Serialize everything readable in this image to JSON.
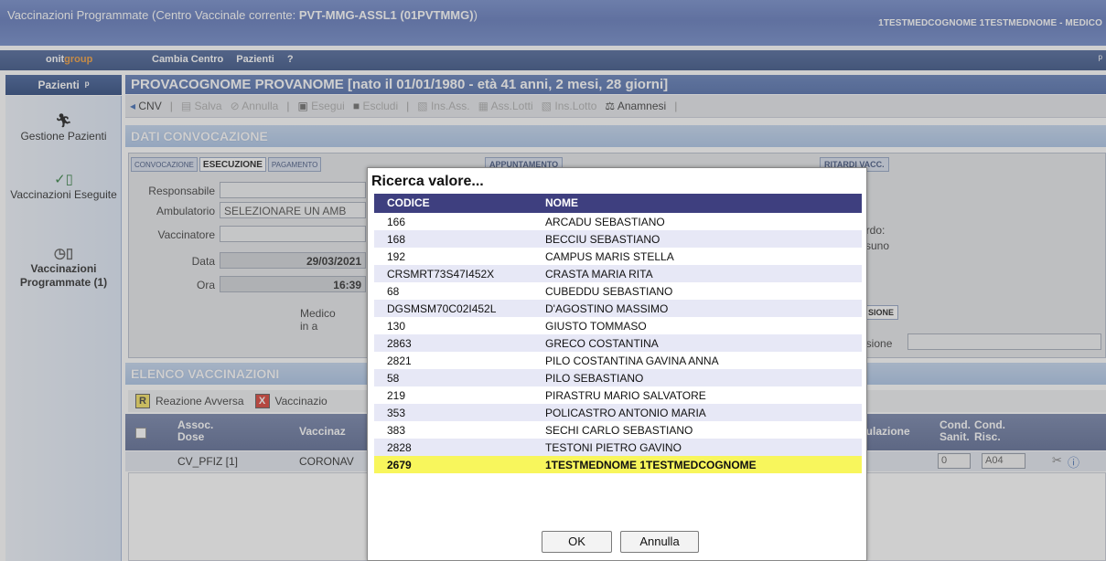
{
  "window": {
    "title_prefix": "Vaccinazioni Programmate (Centro Vaccinale corrente: ",
    "title_center": "PVT-MMG-ASSL1 (01PVTMMG)",
    "title_suffix": ")",
    "user": "1TESTMEDCOGNOME 1TESTMEDNOME - MEDICO"
  },
  "menu": {
    "logo_a": "onit",
    "logo_b": "group",
    "items": [
      "Cambia Centro",
      "Pazienti",
      "?"
    ]
  },
  "sidebar": {
    "header": "Pazienti",
    "items": [
      {
        "icon": "running-person-icon",
        "label": "Gestione Pazienti"
      },
      {
        "icon": "vial-check-icon",
        "label": "Vaccinazioni Eseguite"
      },
      {
        "icon": "vial-clock-icon",
        "label": "Vaccinazioni Programmate (1)"
      }
    ]
  },
  "patient_banner": "PROVACOGNOME PROVANOME [nato il 01/01/1980 - età 41 anni, 2 mesi, 28 giorni]",
  "toolbar": {
    "cnv": "CNV",
    "salva": "Salva",
    "annulla": "Annulla",
    "esegui": "Esegui",
    "escludi": "Escludi",
    "ins_ass": "Ins.Ass.",
    "ass_lotti": "Ass.Lotti",
    "ins_lotto": "Ins.Lotto",
    "anamnesi": "Anamnesi"
  },
  "dati": {
    "header": "DATI CONVOCAZIONE",
    "tabs": [
      "CONVOCAZIONE",
      "ESECUZIONE",
      "PAGAMENTO"
    ],
    "tab_appuntamento": "APPUNTAMENTO",
    "tab_ritardi": "RITARDI VACC.",
    "tab_sione": "SIONE",
    "responsabile_label": "Responsabile",
    "ambulatorio_label": "Ambulatorio",
    "ambulatorio_value": "SELEZIONARE UN AMB",
    "vaccinatore_label": "Vaccinatore",
    "data_label": "Data",
    "data_value": "29/03/2021",
    "ora_label": "Ora",
    "ora_value": "16:39",
    "medico_text": "Medico in a",
    "ritardo_text": "ardo:",
    "nessuno_text": "ssuno",
    "sione_label": "nsione"
  },
  "elenco": {
    "header": "ELENCO VACCINAZIONI",
    "reazione": "Reazione Avversa",
    "vaccinazione_trunc": "Vaccinazio",
    "col_assoc": "Assoc.",
    "col_dose": "Dose",
    "col_vaccinaz": "Vaccinaz",
    "col_circolazione": "culazione",
    "col_cond1": "Cond.",
    "col_sanit": "Sanit.",
    "col_cond2": "Cond.",
    "col_risc": "Risc.",
    "row_assoc": "CV_PFIZ [1]",
    "row_vacc": "CORONAV",
    "row_cond": "0",
    "row_risc": "A04"
  },
  "modal": {
    "title": "Ricerca valore...",
    "col_codice": "CODICE",
    "col_nome": "NOME",
    "rows": [
      {
        "codice": "166",
        "nome": "ARCADU SEBASTIANO"
      },
      {
        "codice": "168",
        "nome": "BECCIU SEBASTIANO"
      },
      {
        "codice": "192",
        "nome": "CAMPUS MARIS STELLA"
      },
      {
        "codice": "CRSMRT73S47I452X",
        "nome": "CRASTA MARIA RITA"
      },
      {
        "codice": "68",
        "nome": "CUBEDDU SEBASTIANO"
      },
      {
        "codice": "DGSMSM70C02I452L",
        "nome": "D'AGOSTINO MASSIMO"
      },
      {
        "codice": "130",
        "nome": "GIUSTO TOMMASO"
      },
      {
        "codice": "2863",
        "nome": "GRECO COSTANTINA"
      },
      {
        "codice": "2821",
        "nome": "PILO COSTANTINA GAVINA ANNA"
      },
      {
        "codice": "58",
        "nome": "PILO SEBASTIANO"
      },
      {
        "codice": "219",
        "nome": "PIRASTRU MARIO SALVATORE"
      },
      {
        "codice": "353",
        "nome": "POLICASTRO ANTONIO MARIA"
      },
      {
        "codice": "383",
        "nome": "SECHI CARLO SEBASTIANO"
      },
      {
        "codice": "2828",
        "nome": "TESTONI PIETRO GAVINO"
      },
      {
        "codice": "2679",
        "nome": "1TESTMEDNOME 1TESTMEDCOGNOME"
      }
    ],
    "ok": "OK",
    "annulla": "Annulla"
  },
  "colors": {
    "selected_row": "#f8f65c",
    "grid_header": "#3e3f7f",
    "title_bar": "#6d86c8"
  }
}
